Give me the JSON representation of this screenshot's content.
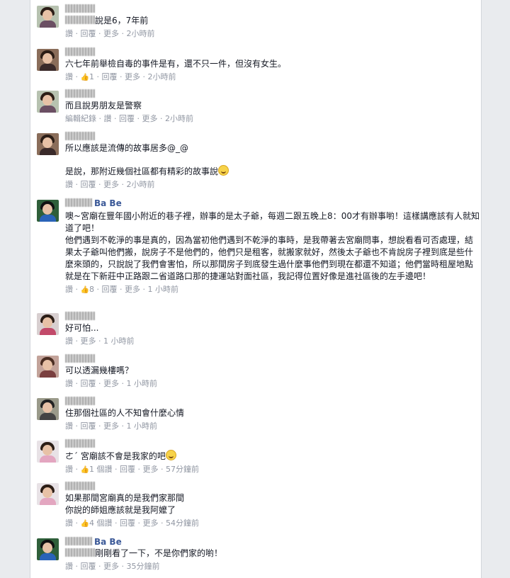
{
  "meta_words": {
    "like": "讚",
    "reply": "回覆",
    "more": "更多",
    "history": "編輯紀錄"
  },
  "comments": [
    {
      "text": "說是6，7年前",
      "time": "2小時前"
    },
    {
      "text": "六七年前舉檢自毒的事件是有，還不只一件，但沒有女生。",
      "likes": "1",
      "time": "2小時前"
    },
    {
      "text": "而且說男朋友是警察",
      "time": "2小時前"
    },
    {
      "text1": "所以應該是流傳的故事居多@_@",
      "text2": "是說，那附近幾個社區都有精彩的故事說",
      "time": "2小時前"
    },
    {
      "name": "Ba Be",
      "text1": "噢~宮廟在豐年國小附近的巷子裡，辦事的是太子爺，每週二跟五晚上8：00才有辦事喲！這樣講應該有人就知道了吧！",
      "text2": "他們遇到不乾淨的事是真的，因為當初他們遇到不乾淨的事時，是我帶著去宮廟問事，想說看看可否處理，結果太子爺叫他們搬，說房子不是他們的，他們只是租客，就搬家就好，然後太子爺也不肯說房子裡到底是些什麼來頭的，只說說了我們會害怕，所以那間房子到底發生過什麼事他們到現在都還不知道；他們當時租屋地點就是在下新莊中正路跟二省道路口那的捷運站對面社區，我記得位置好像是進社區後的左手邊吧！",
      "likes": "8",
      "time": "1 小時前"
    },
    {
      "text": "好可怕...",
      "time": "1 小時前"
    },
    {
      "text": "可以透漏幾樓嗎？",
      "time": "1 小時前"
    },
    {
      "text": "住那個社區的人不知會什麼心情",
      "time": "1 小時前"
    },
    {
      "text": "ㄜˊ 宮廟該不會是我家的吧",
      "likes": "1 個讚",
      "time": "57分鐘前"
    },
    {
      "text1": "如果那間宮廟真的是我們家那間",
      "text2": "你說的師姐應該就是我阿嬤了",
      "likes": "4 個讚",
      "time": "54分鐘前"
    },
    {
      "name": "Ba Be",
      "text": "剛剛看了一下，不是你們家的喲！",
      "time": "35分鐘前"
    }
  ]
}
